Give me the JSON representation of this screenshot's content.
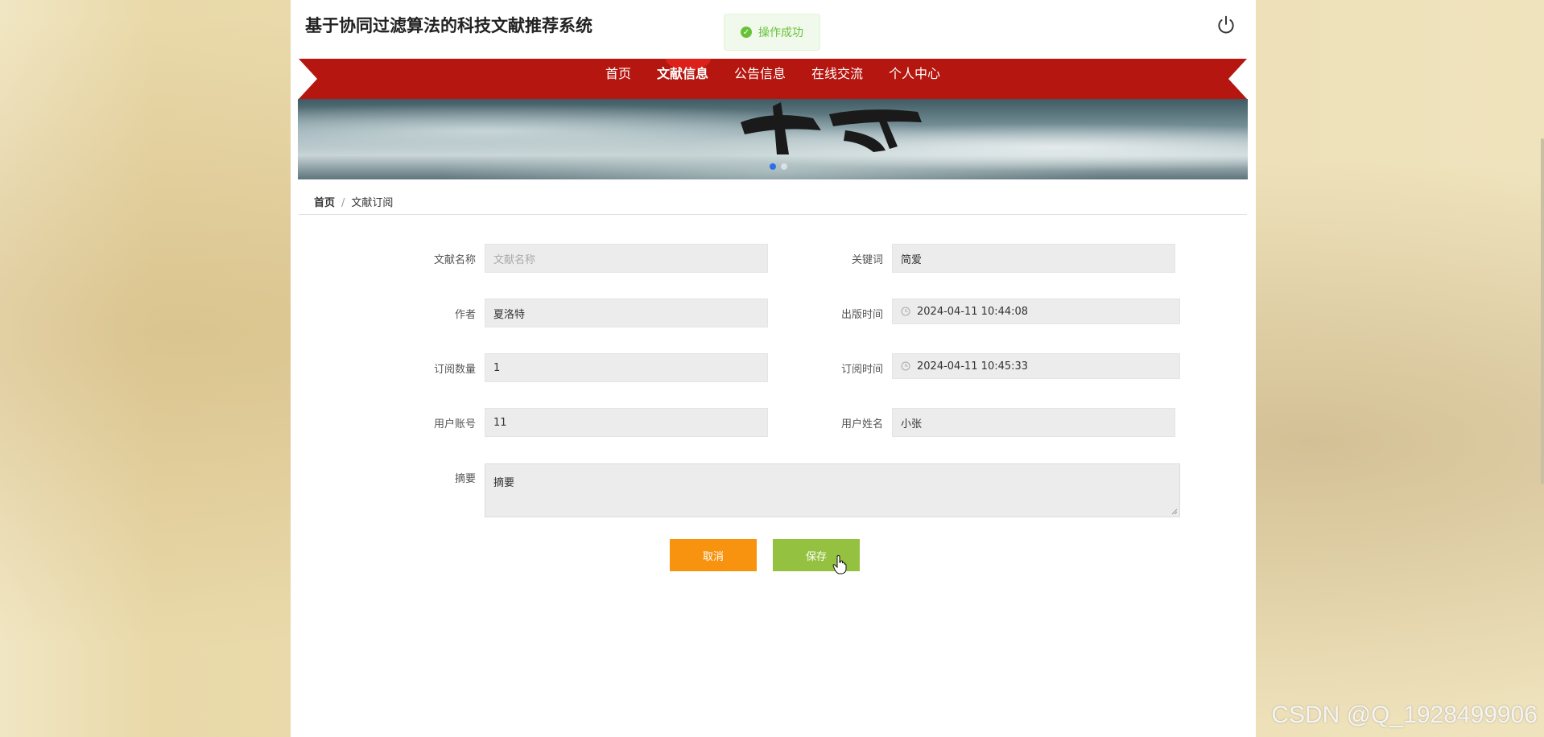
{
  "app": {
    "title": "基于协同过滤算法的科技文献推荐系统"
  },
  "toast": {
    "message": "操作成功",
    "icon": "check-circle-icon",
    "color": "#67c23a"
  },
  "nav": {
    "items": [
      {
        "label": "首页",
        "active": false
      },
      {
        "label": "文献信息",
        "active": true
      },
      {
        "label": "公告信息",
        "active": false
      },
      {
        "label": "在线交流",
        "active": false
      },
      {
        "label": "个人中心",
        "active": false
      }
    ],
    "color": "#b5160f"
  },
  "breadcrumb": {
    "home": "首页",
    "separator": "/",
    "current": "文献订阅"
  },
  "form": {
    "title_label": "文献名称",
    "title_placeholder": "文献名称",
    "keyword_label": "关键词",
    "keyword_value": "简爱",
    "author_label": "作者",
    "author_value": "夏洛特",
    "publish_time_label": "出版时间",
    "publish_time_value": "2024-04-11 10:44:08",
    "quantity_label": "订阅数量",
    "quantity_value": "1",
    "subscribe_time_label": "订阅时间",
    "subscribe_time_value": "2024-04-11 10:45:33",
    "account_label": "用户账号",
    "account_value": "11",
    "username_label": "用户姓名",
    "username_value": "小张",
    "abstract_label": "摘要",
    "abstract_value": "摘要"
  },
  "buttons": {
    "cancel": "取消",
    "cancel_color": "#f7930e",
    "save": "保存",
    "save_color": "#94c240"
  },
  "watermark": "CSDN @Q_1928499906"
}
